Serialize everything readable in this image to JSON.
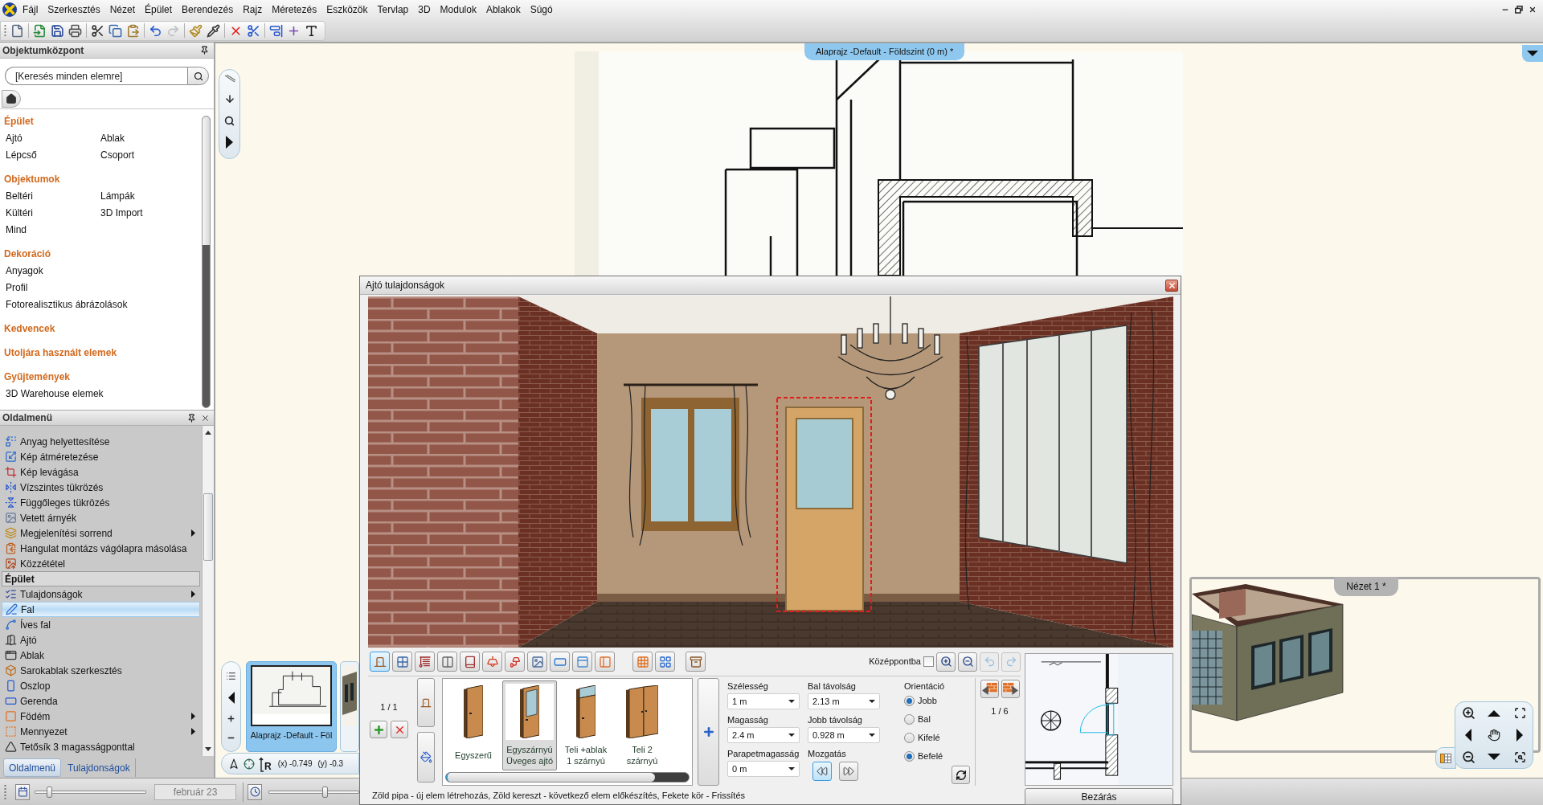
{
  "menu_bar": {
    "items": [
      "Fájl",
      "Szerkesztés",
      "Nézet",
      "Épület",
      "Berendezés",
      "Rajz",
      "Méretezés",
      "Eszközök",
      "Tervlap",
      "3D",
      "Modulok",
      "Ablakok",
      "Súgó"
    ]
  },
  "toolbar": [
    {
      "disabled": false
    },
    {
      "disabled": false
    },
    {
      "disabled": false
    },
    {
      "disabled": false
    },
    {
      "disabled": false
    },
    {
      "disabled": false
    },
    {
      "disabled": false
    },
    {
      "disabled": false
    },
    {
      "disabled": true
    },
    {
      "disabled": false
    },
    {
      "disabled": false
    },
    {
      "disabled": false
    },
    {
      "disabled": false
    },
    {
      "disabled": false
    },
    {
      "disabled": false
    },
    {
      "disabled": false
    }
  ],
  "object_center": {
    "title": "Objektumközpont",
    "search": {
      "placeholder": "[Keresés minden elemre]"
    },
    "sections": [
      {
        "title": "Épület",
        "kind": "grid",
        "items": [
          "Ajtó",
          "Ablak",
          "Lépcső",
          "Csoport"
        ]
      },
      {
        "title": "Objektumok",
        "kind": "grid",
        "items": [
          "Beltéri",
          "Lámpák",
          "Kültéri",
          "3D Import",
          "Mind"
        ]
      },
      {
        "title": "Dekoráció",
        "kind": "list",
        "items": [
          "Anyagok",
          "Profil",
          "Fotorealisztikus ábrázolások"
        ]
      },
      {
        "title": "Kedvencek"
      },
      {
        "title": "Utoljára használt elemek"
      },
      {
        "title": "Gyűjtemények",
        "kind": "list",
        "items": [
          "3D Warehouse elemek"
        ]
      }
    ]
  },
  "side_menu": {
    "title": "Oldalmenü",
    "items": [
      {
        "kind": "item",
        "label": "Anyag helyettesítése",
        "submenu": false,
        "selected": false
      },
      {
        "kind": "item",
        "label": "Kép átméretezése",
        "submenu": false,
        "selected": false
      },
      {
        "kind": "item",
        "label": "Kép levágása",
        "submenu": false,
        "selected": false
      },
      {
        "kind": "item",
        "label": "Vízszintes tükrözés",
        "submenu": false,
        "selected": false
      },
      {
        "kind": "item",
        "label": "Függőleges tükrözés",
        "submenu": false,
        "selected": false
      },
      {
        "kind": "item",
        "label": "Vetett árnyék",
        "submenu": false,
        "selected": false
      },
      {
        "kind": "item",
        "label": "Megjelenítési sorrend",
        "submenu": true,
        "selected": false
      },
      {
        "kind": "item",
        "label": "Hangulat montázs vágólapra másolása",
        "submenu": false,
        "selected": false
      },
      {
        "kind": "item",
        "label": "Közzététel",
        "submenu": false,
        "selected": false
      },
      {
        "kind": "header",
        "label": "Épület"
      },
      {
        "kind": "item",
        "label": "Tulajdonságok",
        "submenu": true,
        "selected": false
      },
      {
        "kind": "item",
        "label": "Fal",
        "submenu": false,
        "selected": true
      },
      {
        "kind": "item",
        "label": "Íves fal",
        "submenu": false,
        "selected": false
      },
      {
        "kind": "item",
        "label": "Ajtó",
        "submenu": false,
        "selected": false
      },
      {
        "kind": "item",
        "label": "Ablak",
        "submenu": false,
        "selected": false
      },
      {
        "kind": "item",
        "label": "Sarokablak szerkesztés",
        "submenu": false,
        "selected": false
      },
      {
        "kind": "item",
        "label": "Oszlop",
        "submenu": false,
        "selected": false
      },
      {
        "kind": "item",
        "label": "Gerenda",
        "submenu": false,
        "selected": false
      },
      {
        "kind": "item",
        "label": "Födém",
        "submenu": true,
        "selected": false
      },
      {
        "kind": "item",
        "label": "Mennyezet",
        "submenu": true,
        "selected": false
      },
      {
        "kind": "item",
        "label": "Tetősík 3 magasságponttal",
        "submenu": false,
        "selected": false
      }
    ],
    "tabs": [
      {
        "label": "Oldalmenü",
        "selected": true
      },
      {
        "label": "Tulajdonságok",
        "selected": false
      }
    ]
  },
  "status_bar": {
    "date_slider": {
      "level": 0.13
    },
    "date": "február 23",
    "time_slider": {
      "level": 0.62
    }
  },
  "canvas": {
    "floor_plan_tab": "Alaprajz -Default - Földszint (0 m) *",
    "thumbnails": [
      {
        "label": "Alaprajz -Default - Föl",
        "selected": true
      },
      {
        "selected": false
      }
    ],
    "coordinates": {
      "relative_label": "R",
      "x": "(x) -0.749",
      "y": "(y) -0.3"
    },
    "view_window": {
      "title": "Nézet 1 *"
    }
  },
  "dialog": {
    "title": "Ajtó tulajdonságok",
    "category_buttons": [
      {
        "selected": true
      },
      {
        "selected": false
      },
      {
        "selected": false
      },
      {
        "selected": false
      },
      {
        "selected": false
      },
      {
        "selected": false
      },
      {
        "selected": false
      },
      {
        "selected": false
      },
      {
        "selected": false
      },
      {
        "selected": false
      },
      {
        "selected": false
      },
      {
        "selected": false
      },
      {
        "selected": false
      },
      {
        "selected": false
      }
    ],
    "center_checkbox": {
      "label": "Középpontba",
      "checked": false
    },
    "view_buttons": [
      {
        "disabled": false
      },
      {
        "disabled": false
      },
      {
        "disabled": true
      },
      {
        "disabled": true
      }
    ],
    "counter": "1 / 1",
    "door_types": [
      {
        "label": "Egyszerű",
        "kind": "plain",
        "selected": false
      },
      {
        "label": "Egyszárnyú\nÜveges ajtó",
        "kind": "glass",
        "selected": true
      },
      {
        "label": "Teli +ablak\n1 szárnyú",
        "kind": "transom",
        "selected": false
      },
      {
        "label": "Teli 2\nszárnyú",
        "kind": "double",
        "selected": false
      }
    ],
    "fields": [
      {
        "label": "Szélesség",
        "value": "1 m"
      },
      {
        "label": "Magasság",
        "value": "2.4 m"
      },
      {
        "label": "Parapetmagasság",
        "value": "0 m"
      },
      {
        "label": "Bal távolság",
        "value": "2.13 m"
      },
      {
        "label": "Jobb távolság",
        "value": "0.928 m"
      }
    ],
    "move": {
      "label": "Mozgatás",
      "buttons": [
        {
          "selected": true
        },
        {
          "selected": false
        }
      ]
    },
    "orientation": {
      "label": "Orientáció",
      "options": [
        {
          "label": "Jobb",
          "checked": true
        },
        {
          "label": "Bal",
          "checked": false
        },
        {
          "label": "Kifelé",
          "checked": false
        },
        {
          "label": "Befelé",
          "checked": true
        }
      ]
    },
    "wall_counter": "1 / 6",
    "close_button": "Bezárás",
    "hint": "Zöld pipa - új elem létrehozás, Zöld kereszt - következő elem előkészítés, Fekete kör - Frissítés"
  }
}
